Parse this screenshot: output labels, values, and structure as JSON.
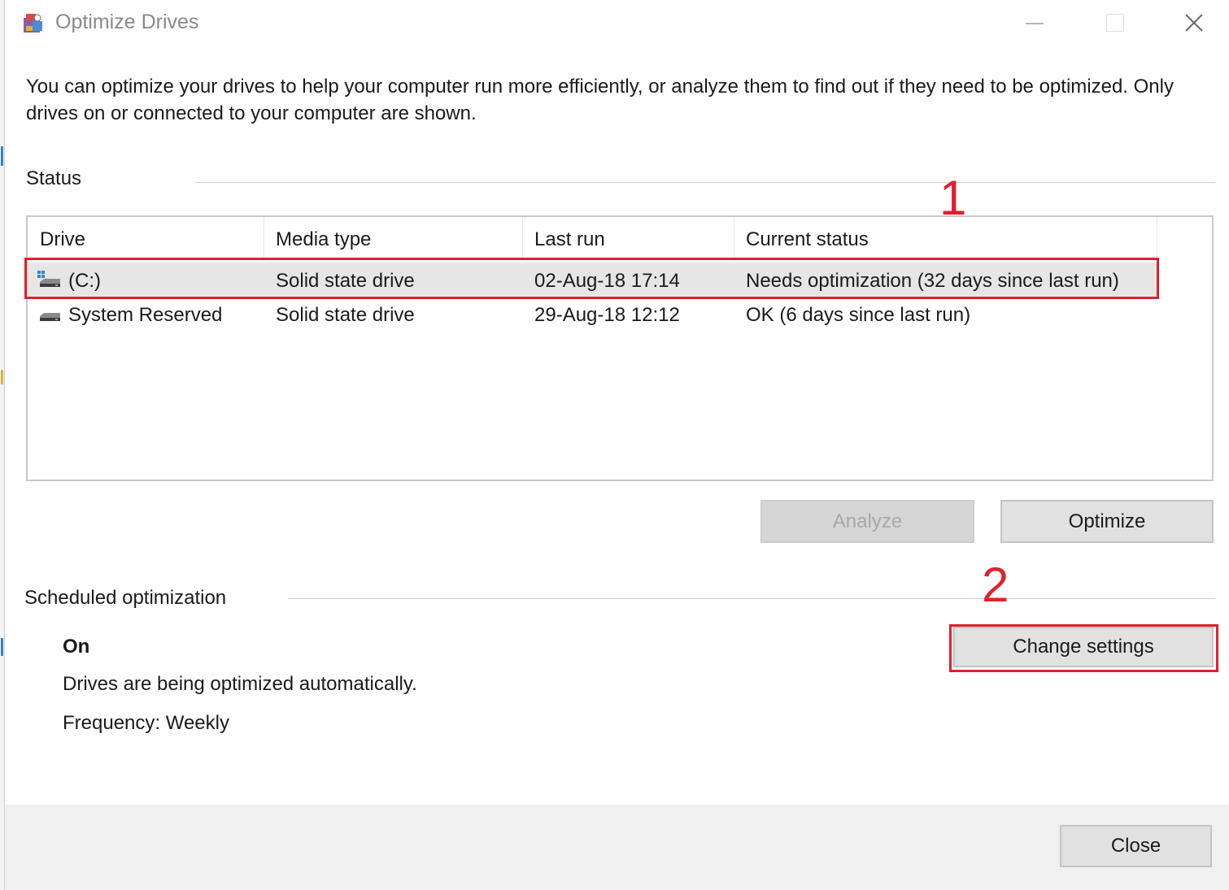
{
  "window": {
    "title": "Optimize Drives",
    "controls": [
      "minimize-icon",
      "maximize-icon",
      "close-icon"
    ]
  },
  "description": "You can optimize your drives to help your computer run more efficiently, or analyze them to find out if they need to be optimized. Only drives on or connected to your computer are shown.",
  "status": {
    "label": "Status",
    "columns": [
      "Drive",
      "Media type",
      "Last run",
      "Current status"
    ],
    "rows": [
      {
        "icon": "windows-drive-icon",
        "drive": "(C:)",
        "media_type": "Solid state drive",
        "last_run": "02-Aug-18 17:14",
        "current_status": "Needs optimization (32 days since last run)",
        "selected": true
      },
      {
        "icon": "drive-icon",
        "drive": "System Reserved",
        "media_type": "Solid state drive",
        "last_run": "29-Aug-18 12:12",
        "current_status": "OK (6 days since last run)",
        "selected": false
      }
    ]
  },
  "actions": {
    "analyze": "Analyze",
    "optimize": "Optimize"
  },
  "scheduled": {
    "label": "Scheduled optimization",
    "state": "On",
    "description": "Drives are being optimized automatically.",
    "frequency": "Frequency: Weekly",
    "change_settings": "Change settings"
  },
  "annotations": {
    "marker_1": "1",
    "marker_2": "2",
    "color": "#e0202e"
  },
  "footer": {
    "close": "Close"
  }
}
